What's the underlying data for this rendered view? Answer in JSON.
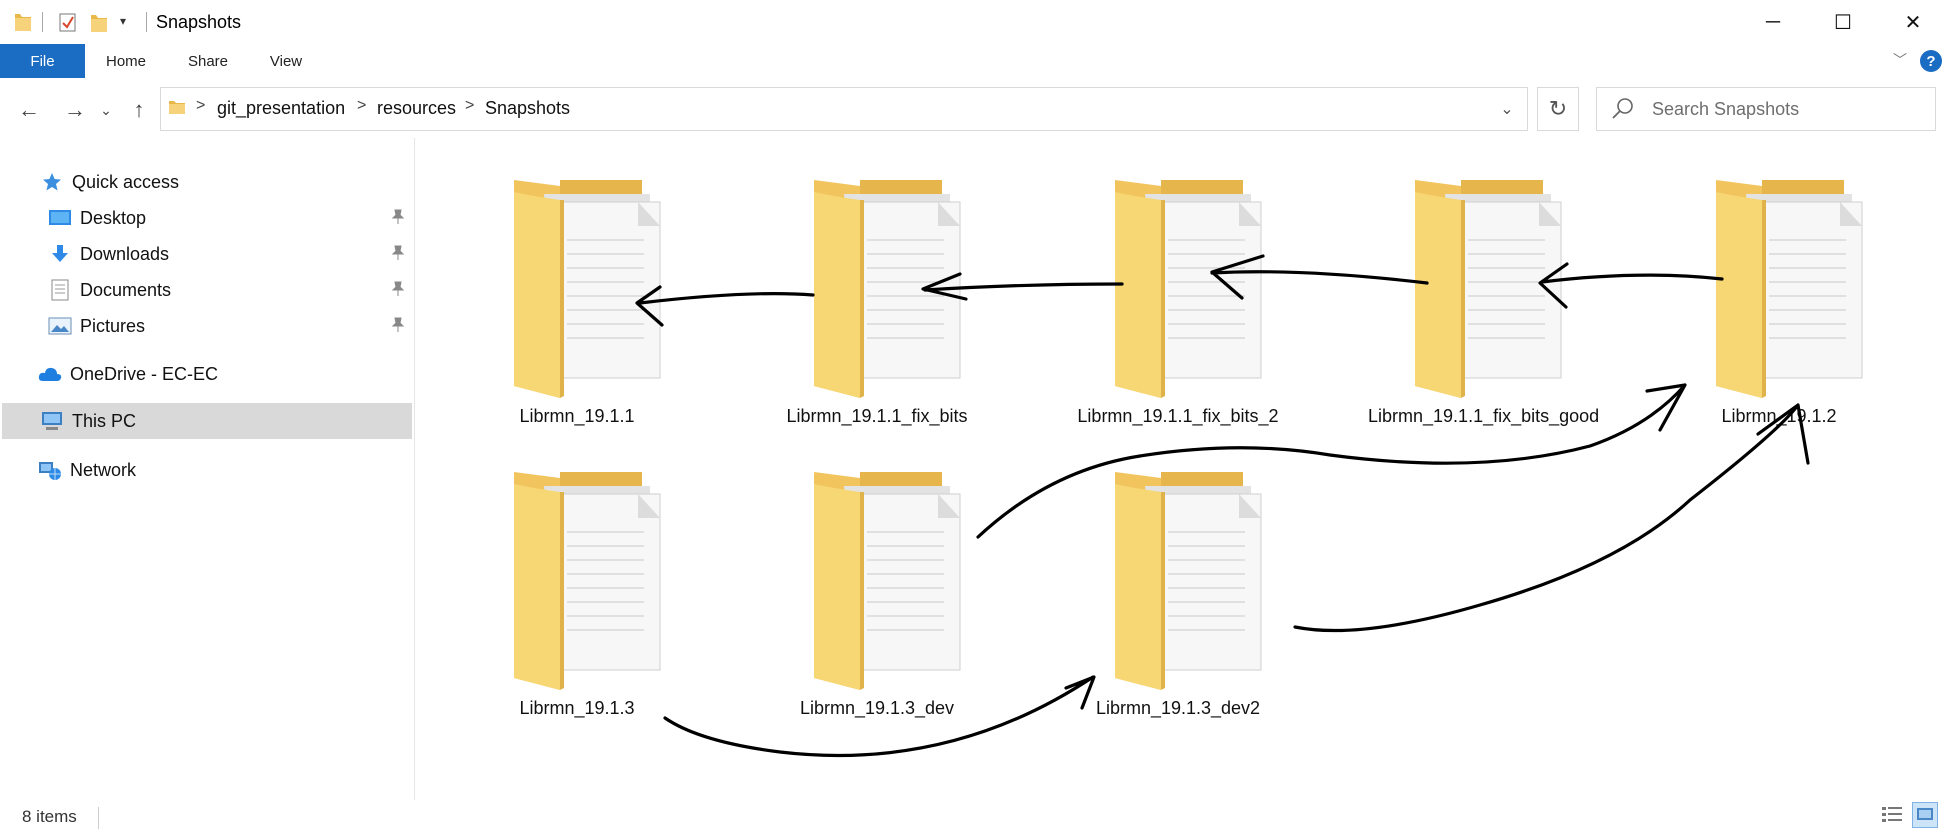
{
  "window": {
    "title": "Snapshots",
    "controls": {
      "minimize": "─",
      "maximize": "☐",
      "close": "✕"
    }
  },
  "ribbon": {
    "tabs": [
      {
        "label": "File",
        "active": true
      },
      {
        "label": "Home"
      },
      {
        "label": "Share"
      },
      {
        "label": "View"
      }
    ],
    "help": "?",
    "accent": "#1a6dc2"
  },
  "navigation": {
    "back": "←",
    "forward": "→",
    "recent": "⌄",
    "up": "↑",
    "breadcrumbs": [
      "git_presentation",
      "resources",
      "Snapshots"
    ],
    "separator": ">",
    "refresh": "↻",
    "dropdown": "⌄"
  },
  "search": {
    "placeholder": "Search Snapshots"
  },
  "sidebar": {
    "items": [
      {
        "label": "Quick access",
        "icon": "star-icon"
      },
      {
        "label": "Desktop",
        "icon": "desktop-icon",
        "pinned": true
      },
      {
        "label": "Downloads",
        "icon": "download-icon",
        "pinned": true
      },
      {
        "label": "Documents",
        "icon": "documents-icon",
        "pinned": true
      },
      {
        "label": "Pictures",
        "icon": "pictures-icon",
        "pinned": true
      },
      {
        "label": "OneDrive - EC-EC",
        "icon": "cloud-icon"
      },
      {
        "label": "This PC",
        "icon": "computer-icon",
        "selected": true
      },
      {
        "label": "Network",
        "icon": "network-icon"
      }
    ]
  },
  "files": [
    {
      "name": "Librmn_19.1.1"
    },
    {
      "name": "Librmn_19.1.1_fix_bits"
    },
    {
      "name": "Librmn_19.1.1_fix_bits_2"
    },
    {
      "name": "Librmn_19.1.1_fix_bits_good"
    },
    {
      "name": "Librmn_19.1.2"
    },
    {
      "name": "Librmn_19.1.3"
    },
    {
      "name": "Librmn_19.1.3_dev"
    },
    {
      "name": "Librmn_19.1.3_dev2"
    }
  ],
  "status": {
    "item_count": "8 items"
  }
}
